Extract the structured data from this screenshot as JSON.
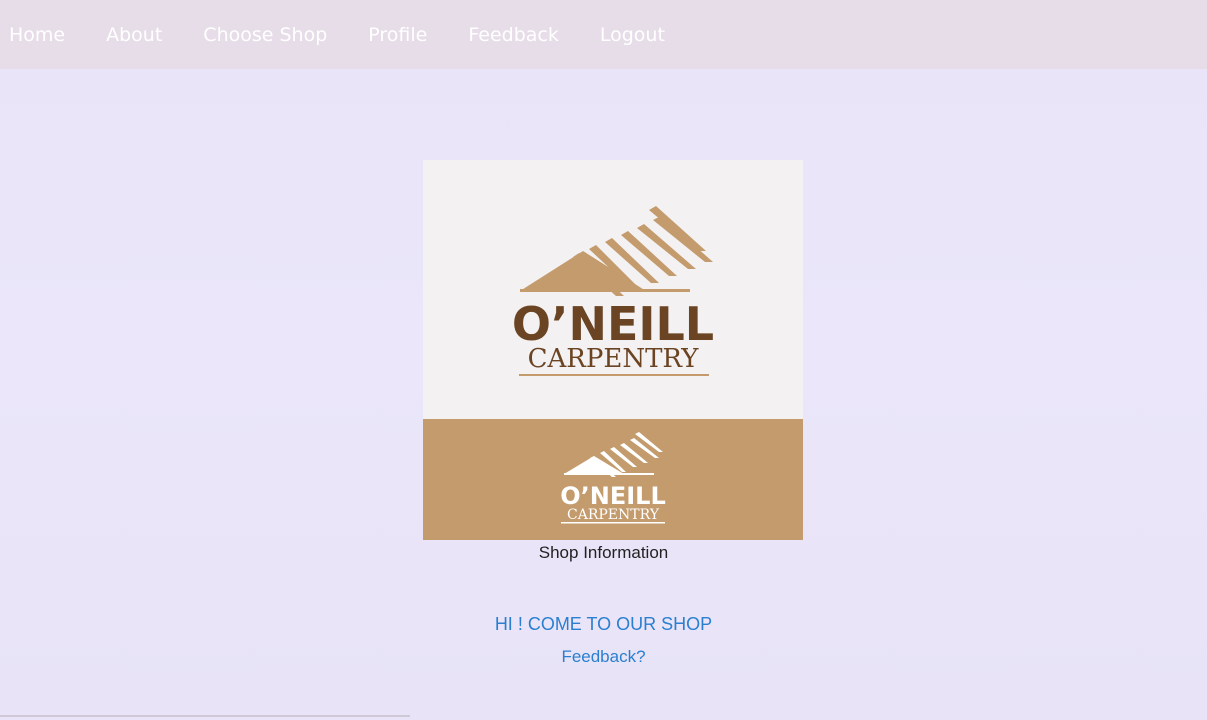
{
  "nav": {
    "items": [
      {
        "label": "Home"
      },
      {
        "label": "About"
      },
      {
        "label": "Choose Shop"
      },
      {
        "label": "Profile"
      },
      {
        "label": "Feedback"
      },
      {
        "label": "Logout"
      }
    ]
  },
  "logo": {
    "top_name": "O’NEILL",
    "top_sub": "CARPENTRY",
    "bottom_name": "O’NEILL",
    "bottom_sub": "CARPENTRY",
    "colors": {
      "brown": "#6b4423",
      "tan": "#c39b6d",
      "cream": "#f3f1f2",
      "white": "#ffffff"
    }
  },
  "shop": {
    "info_label": "Shop Information",
    "greeting": "HI ! COME TO OUR SHOP",
    "feedback_link": "Feedback?"
  },
  "colors": {
    "navbar": "#e6dde8",
    "background": "#ebe6fa",
    "link": "#2a7fd0"
  }
}
